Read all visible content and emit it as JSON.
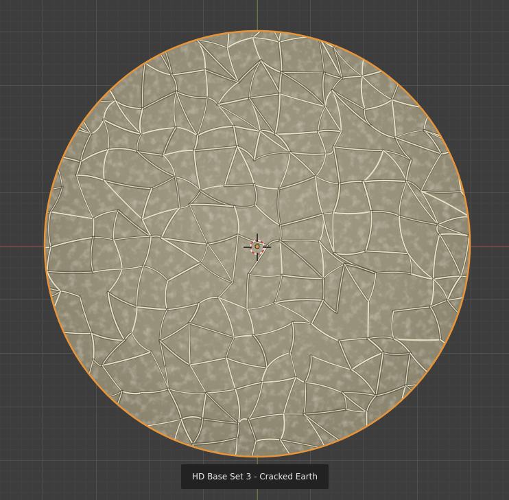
{
  "viewport": {
    "background": "#3d3d3d",
    "x_axis_color": "#8f3f45",
    "y_axis_color": "#617d34"
  },
  "object": {
    "label": "HD Base Set 3 - Cracked Earth",
    "outline_color": "#e8953a",
    "surface_color": "#9c9580",
    "crack_color": "#f2ecd2"
  },
  "icons": {
    "origin": "origin-dot-icon",
    "cursor": "3d-cursor-icon"
  }
}
